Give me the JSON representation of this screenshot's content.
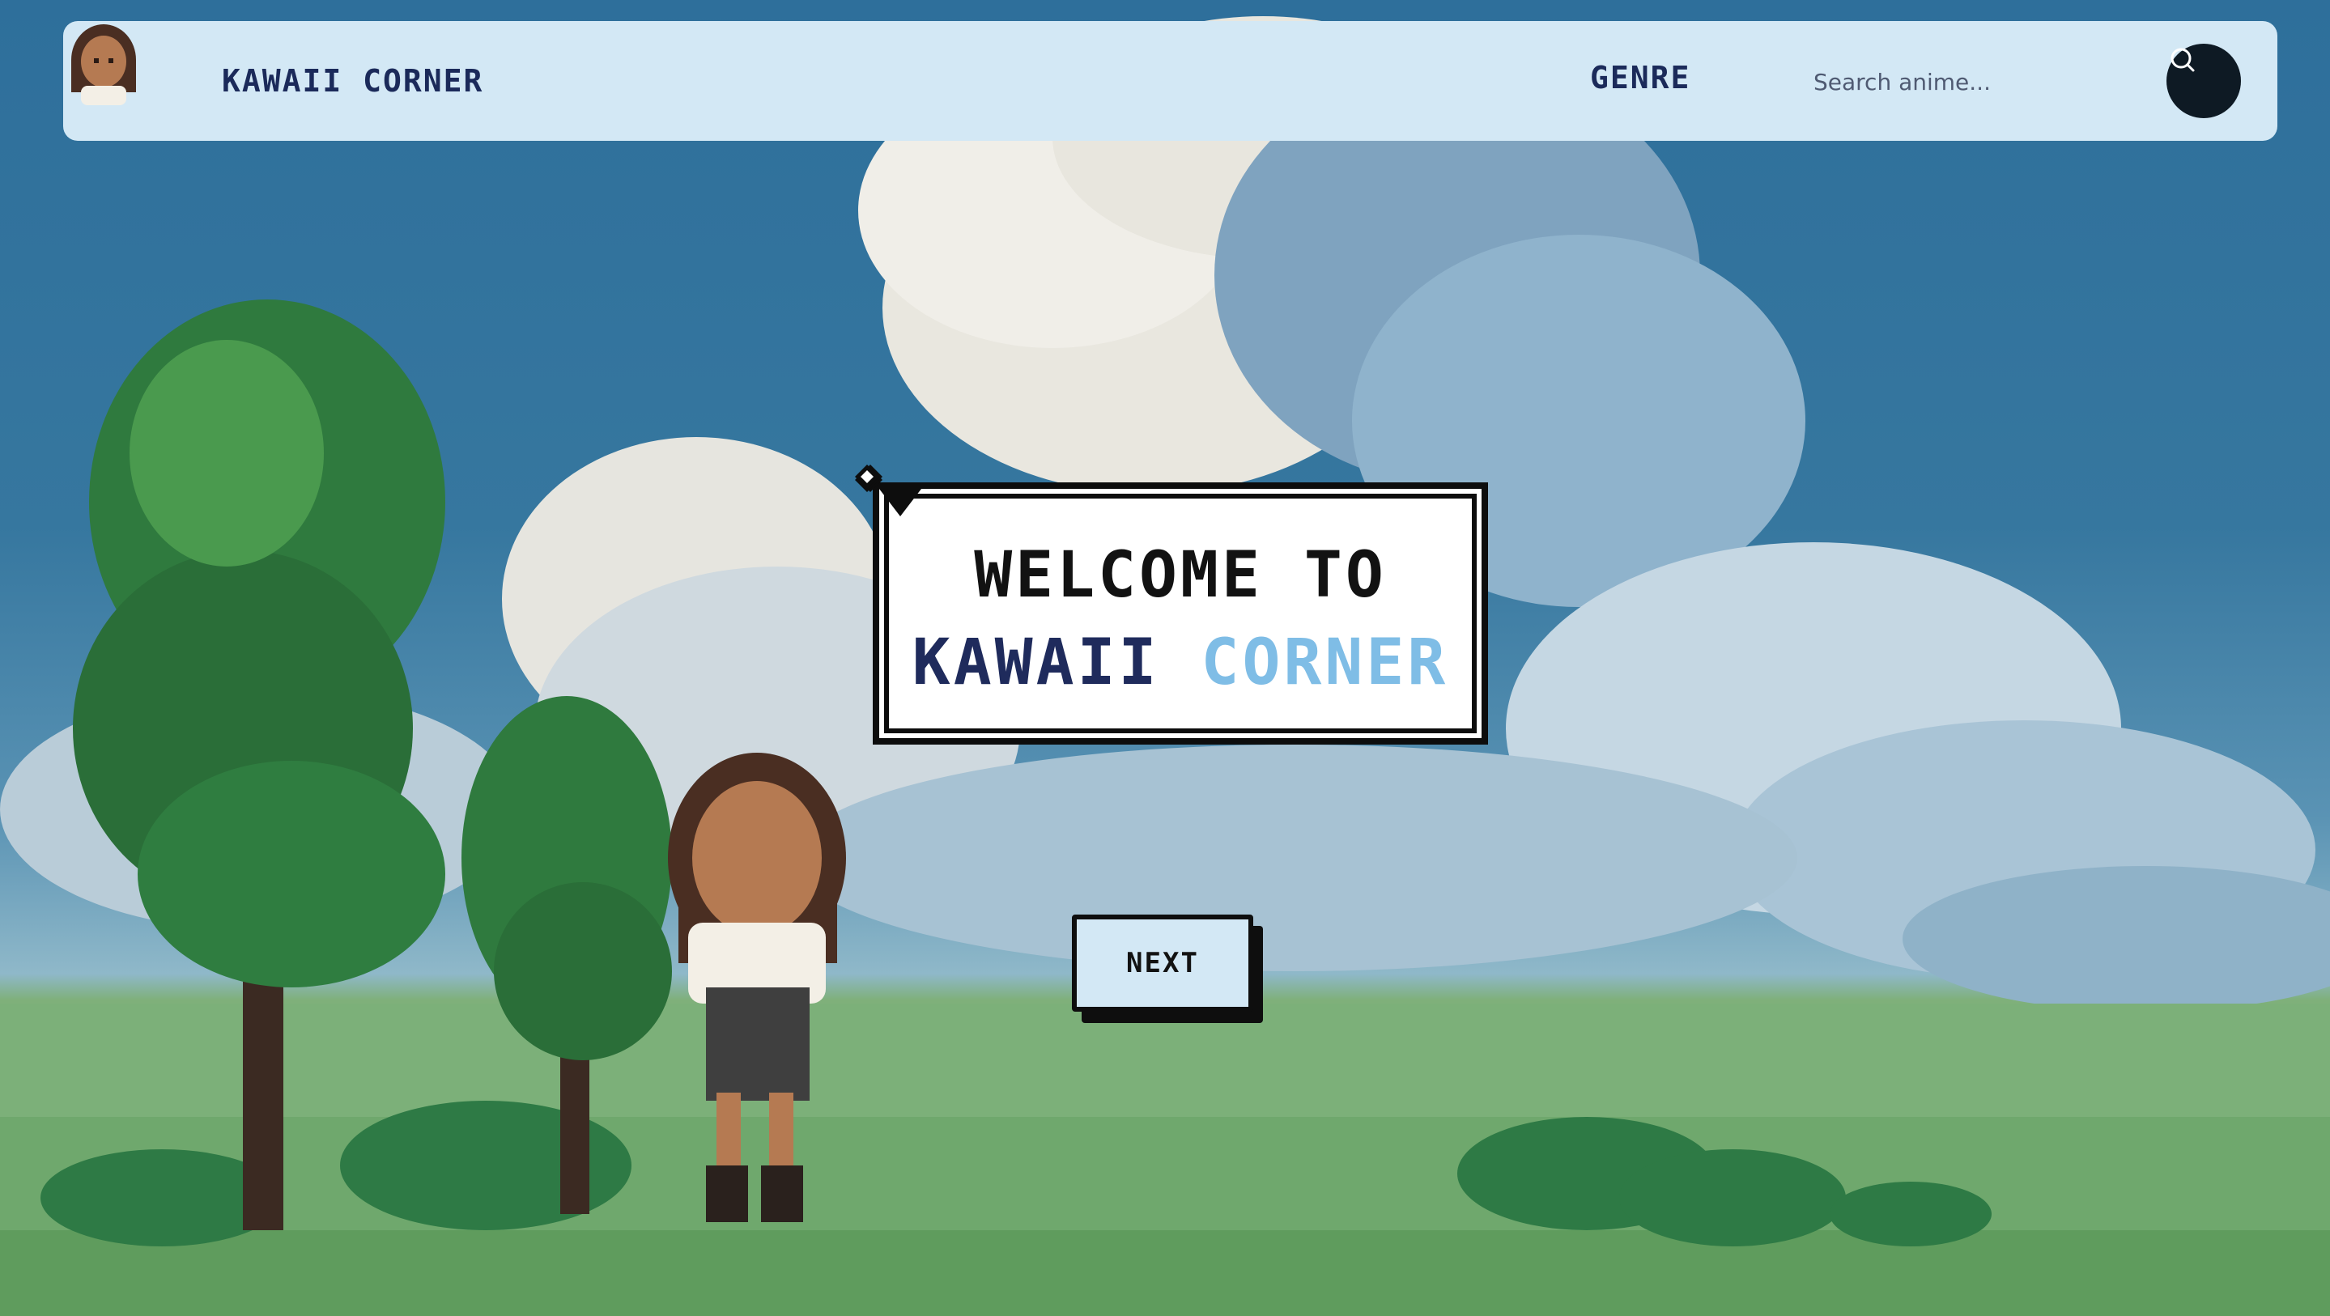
{
  "navbar": {
    "brand": "KAWAII CORNER",
    "genre_label": "GENRE",
    "search_placeholder": "Search anime...",
    "search_icon": "search-icon",
    "avatar_icon": "girl-avatar"
  },
  "dialog": {
    "line1": "WELCOME TO",
    "line2_part1": "KAWAII ",
    "line2_part2": "CORNER"
  },
  "next_button": {
    "label": "NEXT"
  },
  "colors": {
    "navbar_bg": "#d3e8f5",
    "brand_navy": "#1b2a5a",
    "accent_blue": "#7fbde6",
    "sky": "#2e6f9b",
    "grass": "#79ae74"
  }
}
